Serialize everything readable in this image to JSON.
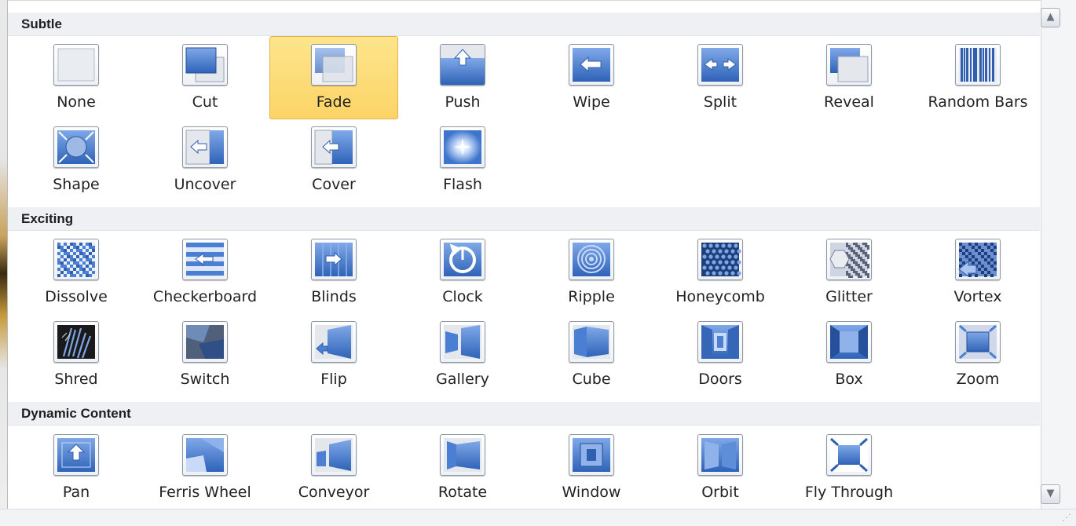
{
  "sections": [
    {
      "title": "Subtle",
      "rows": [
        [
          {
            "label": "None",
            "icon": "none-icon"
          },
          {
            "label": "Cut",
            "icon": "cut-icon"
          },
          {
            "label": "Fade",
            "icon": "fade-icon",
            "selected": true
          },
          {
            "label": "Push",
            "icon": "push-icon"
          },
          {
            "label": "Wipe",
            "icon": "wipe-icon"
          },
          {
            "label": "Split",
            "icon": "split-icon"
          },
          {
            "label": "Reveal",
            "icon": "reveal-icon"
          },
          {
            "label": "Random Bars",
            "icon": "random-bars-icon"
          }
        ],
        [
          {
            "label": "Shape",
            "icon": "shape-icon"
          },
          {
            "label": "Uncover",
            "icon": "uncover-icon"
          },
          {
            "label": "Cover",
            "icon": "cover-icon"
          },
          {
            "label": "Flash",
            "icon": "flash-icon"
          }
        ]
      ]
    },
    {
      "title": "Exciting",
      "rows": [
        [
          {
            "label": "Dissolve",
            "icon": "dissolve-icon"
          },
          {
            "label": "Checkerboard",
            "icon": "checkerboard-icon"
          },
          {
            "label": "Blinds",
            "icon": "blinds-icon"
          },
          {
            "label": "Clock",
            "icon": "clock-icon"
          },
          {
            "label": "Ripple",
            "icon": "ripple-icon"
          },
          {
            "label": "Honeycomb",
            "icon": "honeycomb-icon"
          },
          {
            "label": "Glitter",
            "icon": "glitter-icon"
          },
          {
            "label": "Vortex",
            "icon": "vortex-icon"
          }
        ],
        [
          {
            "label": "Shred",
            "icon": "shred-icon"
          },
          {
            "label": "Switch",
            "icon": "switch-icon"
          },
          {
            "label": "Flip",
            "icon": "flip-icon"
          },
          {
            "label": "Gallery",
            "icon": "gallery-icon"
          },
          {
            "label": "Cube",
            "icon": "cube-icon"
          },
          {
            "label": "Doors",
            "icon": "doors-icon"
          },
          {
            "label": "Box",
            "icon": "box-icon"
          },
          {
            "label": "Zoom",
            "icon": "zoom-icon"
          }
        ]
      ]
    },
    {
      "title": "Dynamic Content",
      "rows": [
        [
          {
            "label": "Pan",
            "icon": "pan-icon"
          },
          {
            "label": "Ferris Wheel",
            "icon": "ferris-wheel-icon"
          },
          {
            "label": "Conveyor",
            "icon": "conveyor-icon"
          },
          {
            "label": "Rotate",
            "icon": "rotate-icon"
          },
          {
            "label": "Window",
            "icon": "window-icon"
          },
          {
            "label": "Orbit",
            "icon": "orbit-icon"
          },
          {
            "label": "Fly Through",
            "icon": "fly-through-icon"
          }
        ]
      ]
    }
  ],
  "scrollbar": {
    "up_glyph": "▲",
    "down_glyph": "▼"
  },
  "resize_grip_glyph": "⋰",
  "colors": {
    "selected_fill": "#fcd466",
    "selected_border": "#e3b249",
    "icon_blue": "#4a7fd4",
    "header_bg": "#eef0f3"
  }
}
